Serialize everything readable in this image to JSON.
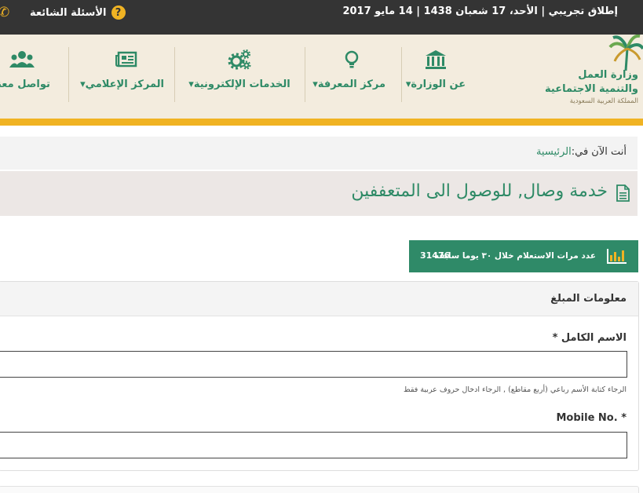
{
  "topbar": {
    "date_line": "إطلاق تجريبي | الأحد، 17 شعبان 1438 | 14 مايو 2017",
    "faq_label": "الأسئلة الشائعة",
    "faq_icon": "question-circle-icon",
    "phone_icon": "phone-icon"
  },
  "logo": {
    "line1": "وزارة العمل",
    "line2": "والتنمية الاجتماعية",
    "line3": "المملكة العربية السعودية"
  },
  "nav": {
    "items": [
      {
        "label": "عن الوزارة",
        "icon": "building-icon"
      },
      {
        "label": "مركز المعرفة",
        "icon": "lightbulb-icon"
      },
      {
        "label": "الخدمات الإلكترونية",
        "icon": "gears-icon"
      },
      {
        "label": "المركز الإعلامي",
        "icon": "newspaper-icon"
      },
      {
        "label": "تواصل معنا",
        "icon": "users-icon"
      }
    ],
    "caret": "▾"
  },
  "breadcrumb": {
    "prefix": "أنت الآن في:",
    "home": "الرئيسية"
  },
  "page": {
    "title": "خدمة وصال, للوصول الى المتعففين"
  },
  "stats": {
    "label": "عدد مرات الاستعلام خلال ٣٠ يوما سابقه",
    "count": "31476"
  },
  "form": {
    "section_title": "معلومات المبلغ",
    "full_name_label": "الاسم الكامل *",
    "full_name_value": "",
    "full_name_hint": "الرجاء كتابة الأسم رباعي (أربع مقاطع) , الرجاء ادخال حروف عربية فقط",
    "mobile_label": "Mobile No. *",
    "mobile_value": ""
  },
  "colors": {
    "accent_green": "#2e8a66",
    "gold": "#f0b323",
    "topbar_bg": "#343434",
    "header_bg": "#f3ecde"
  }
}
